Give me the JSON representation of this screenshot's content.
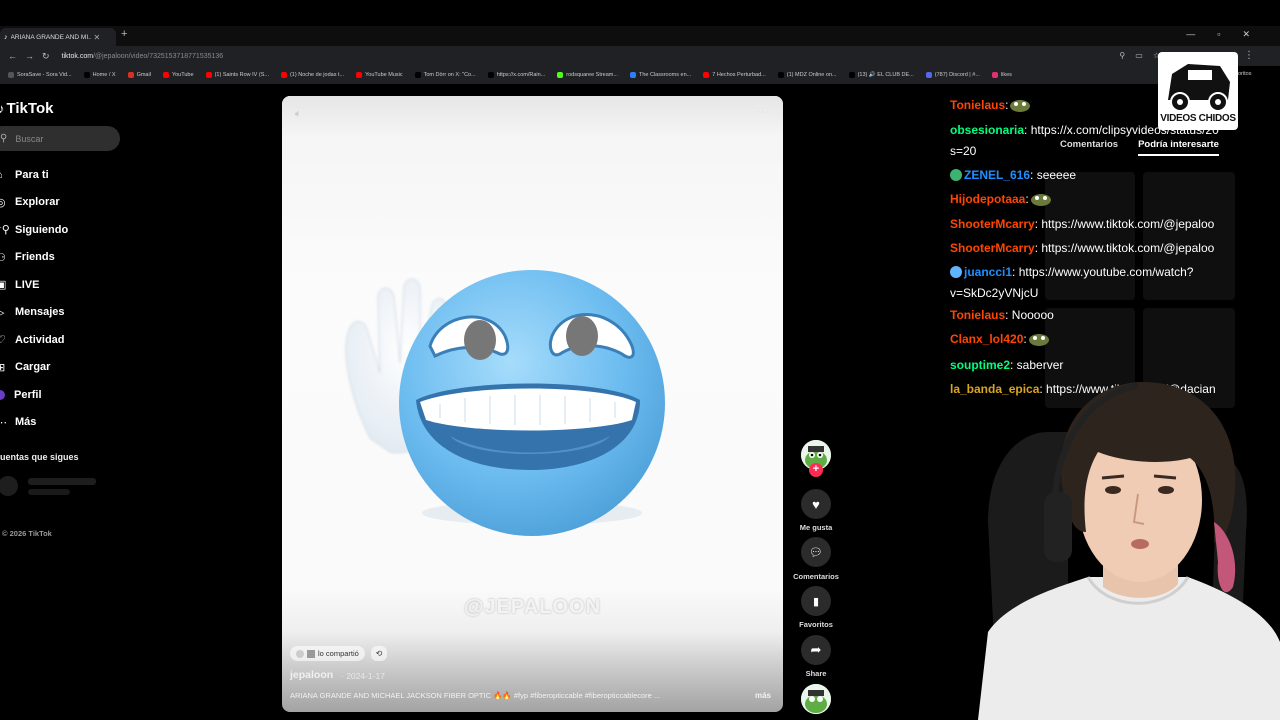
{
  "browser": {
    "tab_title": "ARIANA GRANDE AND MI...",
    "url_host": "tiktok.com",
    "url_path": "/@jepaloon/video/7325153718771535136",
    "bookmarks": [
      {
        "label": "SoraSave - Sora Vid...",
        "color": "#555555"
      },
      {
        "label": "Home / X",
        "color": "#000000"
      },
      {
        "label": "Gmail",
        "color": "#d93025"
      },
      {
        "label": "YouTube",
        "color": "#ff0000"
      },
      {
        "label": "(1) Saints Row IV (S...",
        "color": "#ff0000"
      },
      {
        "label": "(1) Noche de jodas t...",
        "color": "#ff0000"
      },
      {
        "label": "YouTube Music",
        "color": "#ff0000"
      },
      {
        "label": "Tom Dörr on X: \"Co...",
        "color": "#000000"
      },
      {
        "label": "https://x.com/Rain...",
        "color": "#000000"
      },
      {
        "label": "rodsquaree Stream...",
        "color": "#53fc18"
      },
      {
        "label": "The Classrooms en...",
        "color": "#2d7ff9"
      },
      {
        "label": "7 Hechos Perturbad...",
        "color": "#ff0000"
      },
      {
        "label": "(1) MDZ Online on...",
        "color": "#000000"
      },
      {
        "label": "(13) 🔊 EL CLUB DE...",
        "color": "#000000"
      },
      {
        "label": "(787) Discord | #...",
        "color": "#5865f2"
      },
      {
        "label": "likes",
        "color": "#e1306c"
      }
    ],
    "bookmarks_more": "oritos"
  },
  "sidebar": {
    "logo": "TikTok",
    "search_placeholder": "Buscar",
    "items": [
      {
        "label": "Para ti",
        "icon": "home-icon"
      },
      {
        "label": "Explorar",
        "icon": "compass-icon"
      },
      {
        "label": "Siguiendo",
        "icon": "following-icon"
      },
      {
        "label": "Friends",
        "icon": "friends-icon"
      },
      {
        "label": "LIVE",
        "icon": "live-icon"
      },
      {
        "label": "Mensajes",
        "icon": "send-icon"
      },
      {
        "label": "Actividad",
        "icon": "activity-icon"
      },
      {
        "label": "Cargar",
        "icon": "upload-icon"
      },
      {
        "label": "Perfil",
        "icon": "profile-avatar"
      },
      {
        "label": "Más",
        "icon": "more-icon"
      }
    ],
    "following_title": "uentas que sigues",
    "copyright": "© 2026 TikTok"
  },
  "video": {
    "watermark": "@JEPALOON",
    "shared_label": "lo compartió",
    "author": "jepaloon",
    "date": "· 2024-1-17",
    "caption": "ARIANA GRANDE AND MICHAEL JACKSON FIBER OPTIC 🔥🔥 #fyp #fiberopticcable #fiberopticcablecore ...",
    "more_label": "más"
  },
  "actions": {
    "like_label": "Me gusta",
    "comments_label": "Comentarios",
    "favorites_label": "Favoritos",
    "share_label": "Share"
  },
  "side_tabs": {
    "comments": "Comentarios",
    "related": "Podría interesarte"
  },
  "chat": [
    {
      "user": "Tonielaus",
      "color": "#ff4500",
      "text": ":",
      "emote": true
    },
    {
      "user": "obsesionaria",
      "color": "#00ff7f",
      "text": ": https://x.com/clipsyvideos/status/20",
      "wrap": "s=20"
    },
    {
      "user": "ZENEL_616",
      "color": "#1e90ff",
      "badge": "#3cb371",
      "text": ": seeeee"
    },
    {
      "user": "Hijodepotaaa",
      "color": "#ff4500",
      "text": ":",
      "emote": true
    },
    {
      "user": "ShooterMcarry",
      "color": "#ff4500",
      "text": ": https://www.tiktok.com/@jepaloo"
    },
    {
      "user": "ShooterMcarry",
      "color": "#ff4500",
      "text": ": https://www.tiktok.com/@jepaloo"
    },
    {
      "user": "juancci1",
      "color": "#1e90ff",
      "badge": "#5fb3ff",
      "text": ": https://www.youtube.com/watch?",
      "wrap": "v=SkDc2yVNjcU"
    },
    {
      "user": "Tonielaus",
      "color": "#ff4500",
      "text": ": Nooooo"
    },
    {
      "user": "Clanx_lol420",
      "color": "#ff4500",
      "text": ":",
      "emote": true
    },
    {
      "user": "souptime2",
      "color": "#00ff7f",
      "text": ": saberver"
    },
    {
      "user": "la_banda_epica",
      "color": "#daa520",
      "text": ": https://www.tiktok.com/@dacian"
    }
  ],
  "overlay_logo": "VIDEOS CHIDOS"
}
